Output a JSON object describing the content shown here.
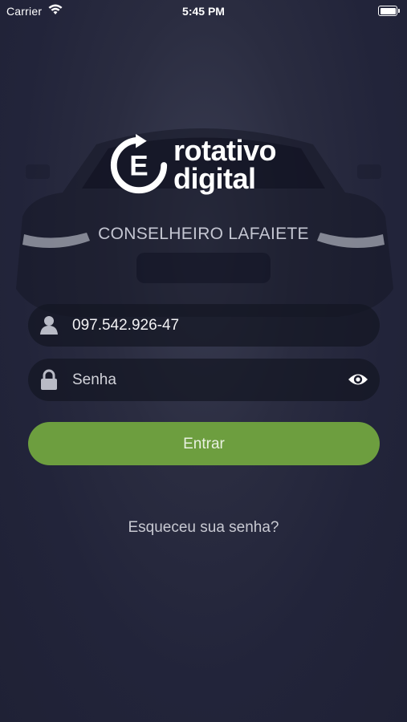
{
  "status_bar": {
    "carrier": "Carrier",
    "time": "5:45 PM"
  },
  "logo": {
    "mark_letter": "E",
    "line1": "rotativo",
    "line2": "digital"
  },
  "city": "CONSELHEIRO LAFAIETE",
  "form": {
    "user_value": "097.542.926-47",
    "password_placeholder": "Senha",
    "submit_label": "Entrar"
  },
  "forgot_link": "Esqueceu sua senha?",
  "colors": {
    "background": "#23253a",
    "accent_button": "#6d9e3f",
    "text_primary": "#ffffff"
  },
  "icons": [
    "wifi-icon",
    "battery-icon",
    "user-icon",
    "lock-icon",
    "eye-icon"
  ]
}
